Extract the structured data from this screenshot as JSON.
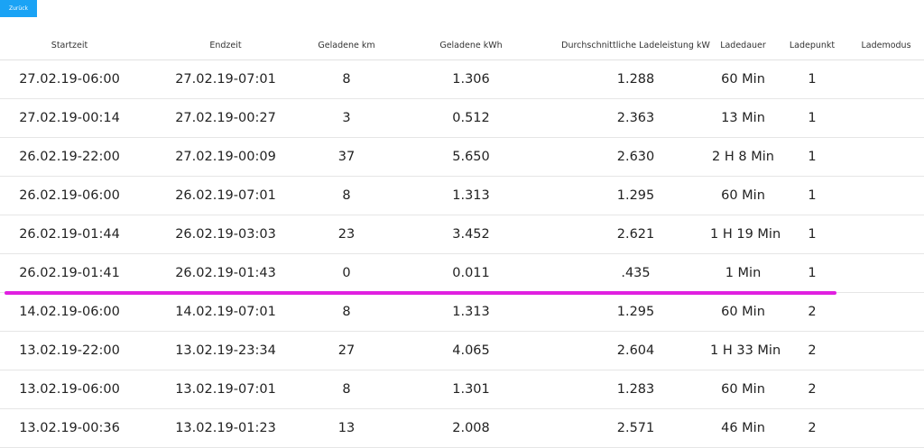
{
  "back_button": {
    "label": "Zurück"
  },
  "table": {
    "headers": [
      "Startzeit",
      "Endzeit",
      "Geladene km",
      "Geladene kWh",
      "Durchschnittliche Ladeleistung kW",
      "Ladedauer",
      "Ladepunkt",
      "Lademodus"
    ],
    "rows": [
      [
        "27.02.19-06:00",
        "27.02.19-07:01",
        "8",
        "1.306",
        "1.288",
        "60 Min",
        "1",
        ""
      ],
      [
        "27.02.19-00:14",
        "27.02.19-00:27",
        "3",
        "0.512",
        "2.363",
        "13 Min",
        "1",
        ""
      ],
      [
        "26.02.19-22:00",
        "27.02.19-00:09",
        "37",
        "5.650",
        "2.630",
        "2 H 8 Min",
        "1",
        ""
      ],
      [
        "26.02.19-06:00",
        "26.02.19-07:01",
        "8",
        "1.313",
        "1.295",
        "60 Min",
        "1",
        ""
      ],
      [
        "26.02.19-01:44",
        "26.02.19-03:03",
        "23",
        "3.452",
        "2.621",
        "1 H 19 Min",
        "1",
        ""
      ],
      [
        "26.02.19-01:41",
        "26.02.19-01:43",
        "0",
        "0.011",
        ".435",
        "1 Min",
        "1",
        ""
      ],
      [
        "14.02.19-06:00",
        "14.02.19-07:01",
        "8",
        "1.313",
        "1.295",
        "60 Min",
        "2",
        ""
      ],
      [
        "13.02.19-22:00",
        "13.02.19-23:34",
        "27",
        "4.065",
        "2.604",
        "1 H 33 Min",
        "2",
        ""
      ],
      [
        "13.02.19-06:00",
        "13.02.19-07:01",
        "8",
        "1.301",
        "1.283",
        "60 Min",
        "2",
        ""
      ],
      [
        "13.02.19-00:36",
        "13.02.19-01:23",
        "13",
        "2.008",
        "2.571",
        "46 Min",
        "2",
        ""
      ]
    ]
  },
  "marker_color": "#e020e0"
}
